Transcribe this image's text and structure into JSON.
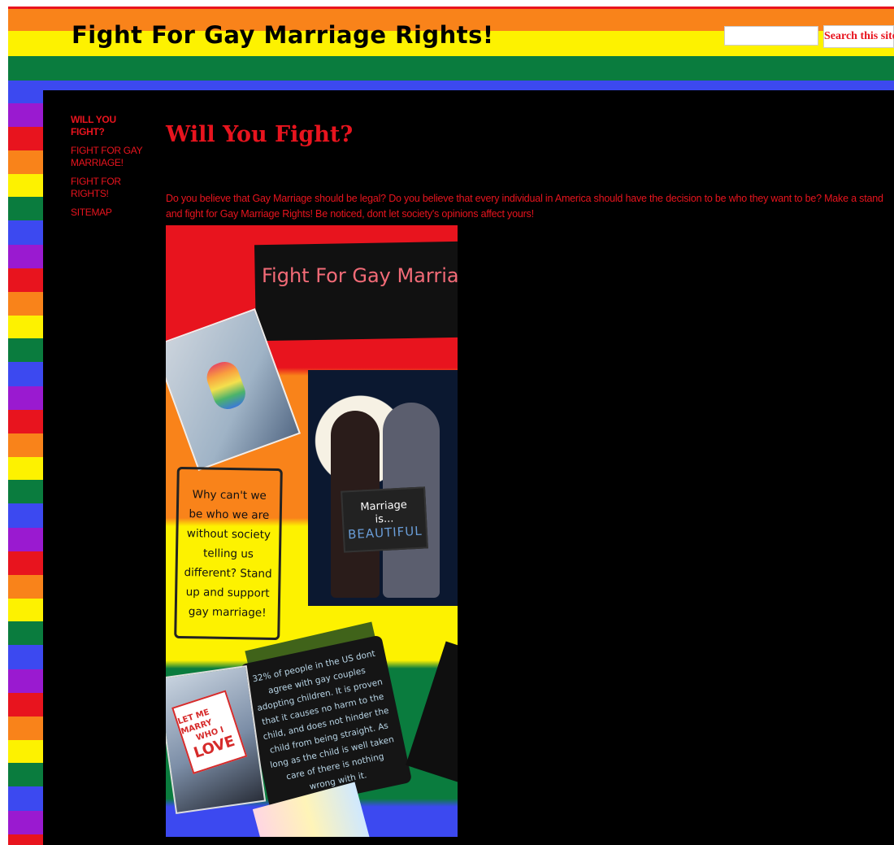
{
  "header": {
    "site_title": "Fight For Gay Marriage Rights!",
    "search_placeholder": "",
    "search_button": "Search this site"
  },
  "nav": {
    "items": [
      {
        "label": "WILL YOU FIGHT?",
        "active": true
      },
      {
        "label": "FIGHT FOR GAY MARRIAGE!",
        "active": false
      },
      {
        "label": "FIGHT FOR RIGHTS!",
        "active": false
      },
      {
        "label": "SITEMAP",
        "active": false
      }
    ]
  },
  "main": {
    "title": "Will You Fight?",
    "intro": "Do you believe that Gay Marriage should be legal? Do you believe that every individual in America should have the decision to be who they want to be? Make a stand and fight for Gay Marriage Rights! Be noticed, dont let society's opinions affect yours!"
  },
  "poster": {
    "title": "Fight For Gay Marriage R",
    "sign_line1": "Marriage",
    "sign_line2": "is...",
    "sign_line3": "BEAUTIFUL",
    "quote": "Why can't we be who we are without society telling us different? Stand up and support gay marriage!",
    "stat": "32% of people in the US dont agree with gay couples adopting children. It is proven that it causes no harm to the child, and does not hinder the child from being straight. As long as the child is well taken care of there is nothing wrong with it.",
    "protest_line1": "LET ME MARRY",
    "protest_line2": "WHO I",
    "protest_line3": "LOVE"
  },
  "colors": {
    "red": "#e8141e",
    "orange": "#f9831a",
    "yellow": "#fdf200",
    "green": "#0a7c3e",
    "blue": "#3c49f0",
    "purple": "#9a1ad0",
    "background": "#000000"
  }
}
